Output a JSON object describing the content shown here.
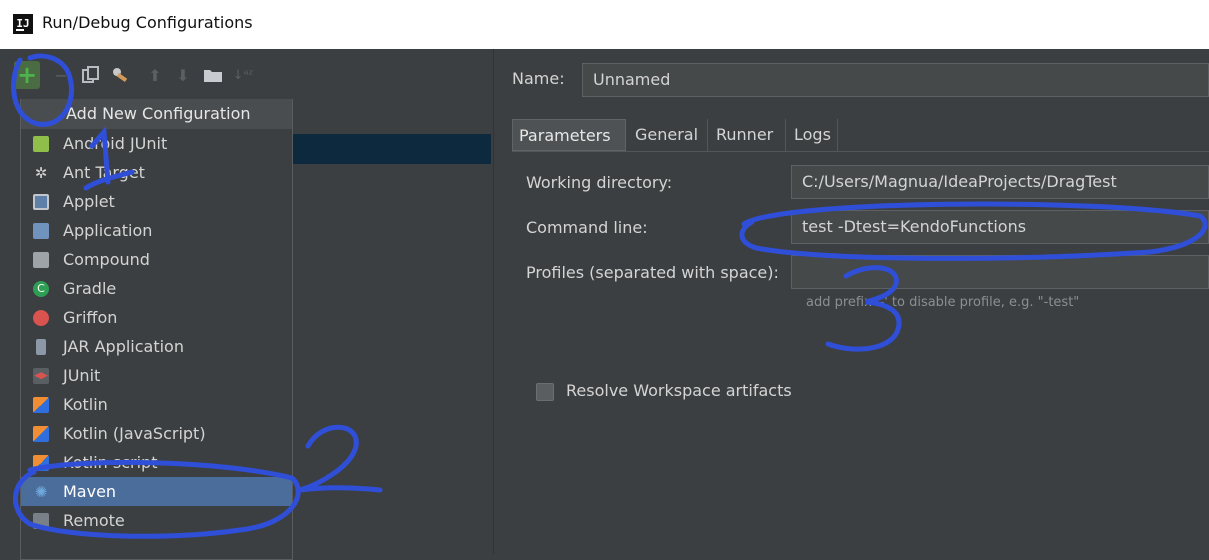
{
  "window": {
    "title": "Run/Debug Configurations",
    "logo_text": "IJ"
  },
  "toolbar": {
    "add_label": "+"
  },
  "popup": {
    "header": "Add New Configuration",
    "items": [
      {
        "label": "Android JUnit",
        "icon": "android-icon"
      },
      {
        "label": "Ant Target",
        "icon": "ant-icon"
      },
      {
        "label": "Applet",
        "icon": "applet-icon"
      },
      {
        "label": "Application",
        "icon": "application-icon"
      },
      {
        "label": "Compound",
        "icon": "compound-icon"
      },
      {
        "label": "Gradle",
        "icon": "gradle-icon"
      },
      {
        "label": "Griffon",
        "icon": "griffon-icon"
      },
      {
        "label": "JAR Application",
        "icon": "jar-icon"
      },
      {
        "label": "JUnit",
        "icon": "junit-icon"
      },
      {
        "label": "Kotlin",
        "icon": "kotlin-icon"
      },
      {
        "label": "Kotlin (JavaScript)",
        "icon": "kotlin-js-icon"
      },
      {
        "label": "Kotlin script",
        "icon": "kotlin-script-icon"
      },
      {
        "label": "Maven",
        "icon": "maven-icon",
        "selected": true
      },
      {
        "label": "Remote",
        "icon": "remote-icon"
      }
    ]
  },
  "config": {
    "name_label": "Name:",
    "name_value": "Unnamed",
    "tabs": [
      "Parameters",
      "General",
      "Runner",
      "Logs"
    ],
    "working_dir_label": "Working directory:",
    "working_dir_value": "C:/Users/Magnua/IdeaProjects/DragTest",
    "command_line_label": "Command line:",
    "command_line_value": "test -Dtest=KendoFunctions",
    "profiles_label": "Profiles (separated with space):",
    "profiles_value": "",
    "profiles_hint": "add prefix '-' to disable profile, e.g. \"-test\"",
    "resolve_label": "Resolve Workspace artifacts"
  },
  "annotations": {
    "one": "1",
    "two": "2",
    "three": "3"
  },
  "colors": {
    "accent": "#4a6d9c",
    "annotation": "#2f4fd8",
    "add_green": "#4db34d"
  }
}
